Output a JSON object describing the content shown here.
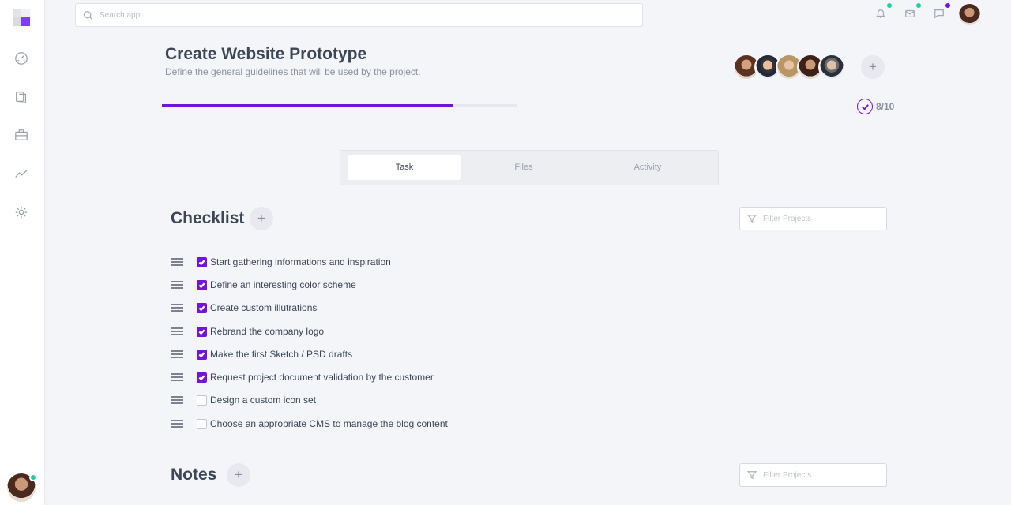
{
  "search": {
    "placeholder": "Search app..."
  },
  "project": {
    "title": "Create Website Prototype",
    "subtitle": "Define the general guidelines that will be used by the project.",
    "progress_fraction": 0.82,
    "tasks_done": "8/10",
    "team_count": 5
  },
  "tabs": [
    {
      "label": "Task",
      "active": true
    },
    {
      "label": "Files",
      "active": false
    },
    {
      "label": "Activity",
      "active": false
    }
  ],
  "checklist": {
    "title": "Checklist",
    "filter_placeholder": "Filter Projects",
    "items": [
      {
        "label": "Start gathering informations and inspiration",
        "checked": true
      },
      {
        "label": "Define an interesting color scheme",
        "checked": true
      },
      {
        "label": "Create custom illutrations",
        "checked": true
      },
      {
        "label": "Rebrand the company logo",
        "checked": true
      },
      {
        "label": "Make the first Sketch / PSD drafts",
        "checked": true
      },
      {
        "label": "Request project document validation by the customer",
        "checked": true
      },
      {
        "label": "Design a custom icon set",
        "checked": false
      },
      {
        "label": "Choose an appropriate CMS to manage the blog content",
        "checked": false
      }
    ]
  },
  "notes": {
    "title": "Notes",
    "filter_placeholder": "Filter Projects"
  },
  "add_symbol": "+",
  "colors": {
    "accent": "#7612dd",
    "notification_teal": "#1ccfa7",
    "notification_purple": "#7612dd"
  }
}
